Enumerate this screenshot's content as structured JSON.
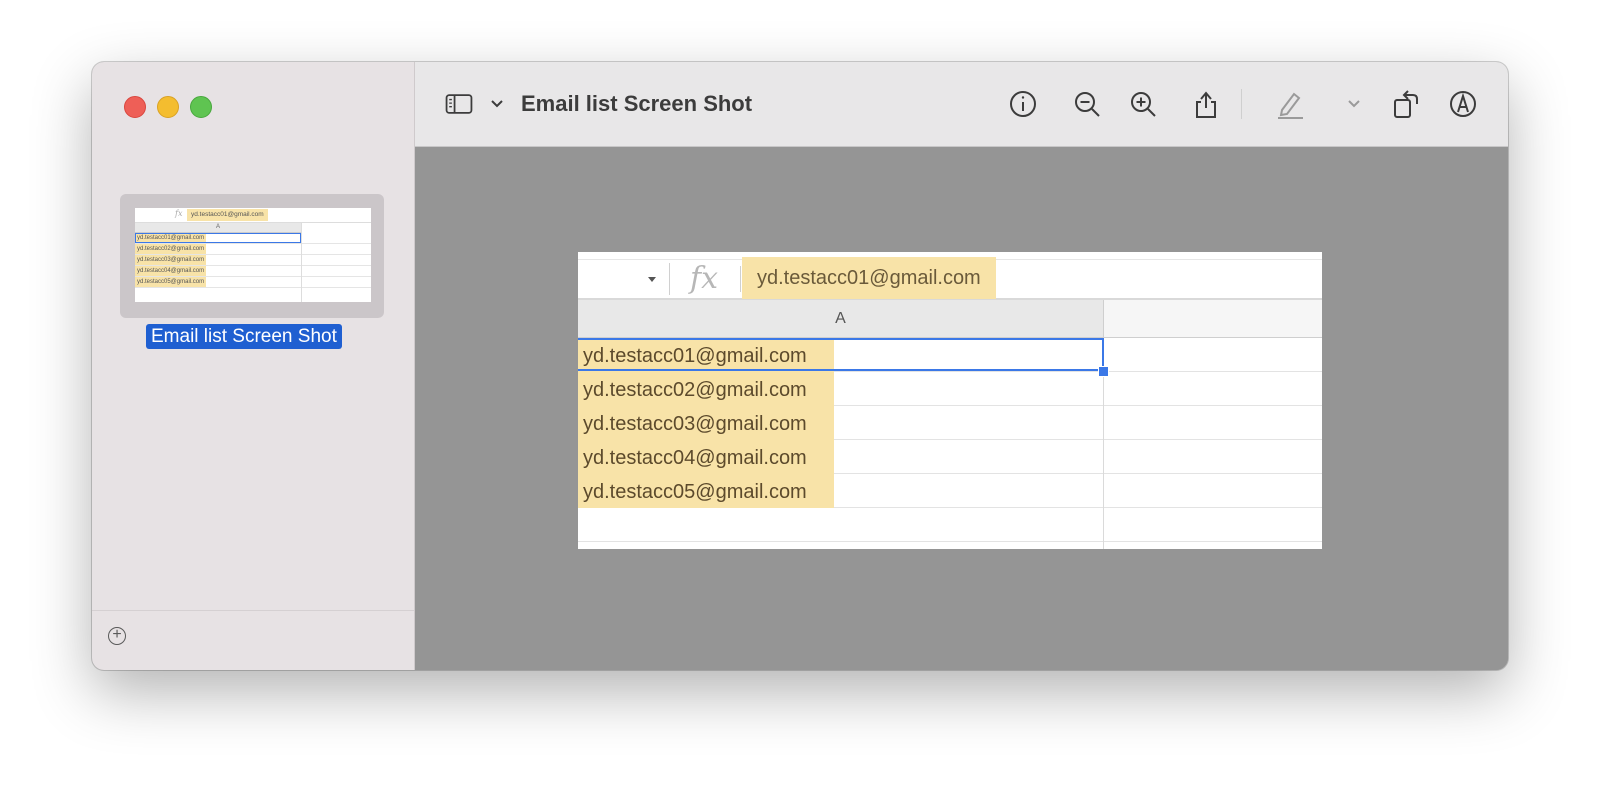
{
  "window": {
    "title": "Email list Screen Shot",
    "controls": [
      "close",
      "minimize",
      "zoom"
    ]
  },
  "sidebar": {
    "thumbnail_label": "Email list Screen Shot",
    "add_icon": "plus-circle-icon",
    "thumbnail": {
      "column_header": "A",
      "formula_value": "yd.testacc01@gmail.com",
      "cells": [
        "yd.testacc01@gmail.com",
        "yd.testacc02@gmail.com",
        "yd.testacc03@gmail.com",
        "yd.testacc04@gmail.com",
        "yd.testacc05@gmail.com"
      ]
    }
  },
  "toolbar": {
    "icons": [
      "sidebar-toggle-icon",
      "chevron-down-icon",
      "info-icon",
      "zoom-out-icon",
      "zoom-in-icon",
      "share-icon",
      "highlight-pen-icon",
      "chevron-down-icon",
      "rotate-icon",
      "markup-icon",
      "search-icon"
    ]
  },
  "document": {
    "fx_label": "fx",
    "formula_value": "yd.testacc01@gmail.com",
    "column_header": "A",
    "rows": [
      "yd.testacc01@gmail.com",
      "yd.testacc02@gmail.com",
      "yd.testacc03@gmail.com",
      "yd.testacc04@gmail.com",
      "yd.testacc05@gmail.com"
    ],
    "highlight_color": "#f8e3a8",
    "selection_color": "#3b78e7"
  }
}
